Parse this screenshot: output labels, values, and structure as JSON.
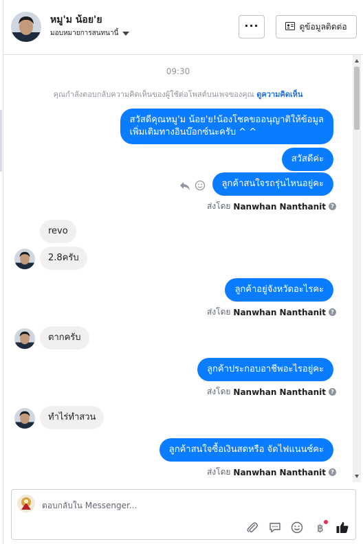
{
  "header": {
    "name": "หมู'ม น้อย'ย",
    "assign_label": "มอบหมายการสนทนานี้",
    "more_label": "···",
    "contact_button": "ดูข้อมูลติดต่อ"
  },
  "chat": {
    "time": "09:30",
    "context_text": "คุณกำลังตอบกลับความคิดเห็นของผู้ใช้ต่อโพสต์บนเพจของคุณ",
    "context_link": "ดูความคิดเห็น",
    "messages": [
      {
        "from": "page",
        "lines": [
          "สวัสดีคุณหมู'ม น้อย'ย!น้องโชคขออนุญาติให้ข้อมูล",
          "เพิ่มเติมทางอินบ๊อกซ์นะครับ ^ ^"
        ]
      },
      {
        "from": "page",
        "text": "สวัสดีค่ะ"
      },
      {
        "from": "page",
        "text": "ลูกค้าสนใจรถรุ่นไหนอยู่คะ"
      },
      {
        "from": "user",
        "text": "revo"
      },
      {
        "from": "user",
        "text": "2.8ครับ"
      },
      {
        "from": "page",
        "text": "ลูกค้าอยู่จังหวัดอะไรคะ"
      },
      {
        "from": "user",
        "text": "ตากครับ"
      },
      {
        "from": "page",
        "text": "ลูกค้าประกอบอาชีพอะไรอยู่คะ"
      },
      {
        "from": "user",
        "text": "ทำไร่ทำสวน"
      },
      {
        "from": "page",
        "text": "ลูกค้าสนใจซื้อเงินสดหรือ จัดไฟแนนซ์คะ"
      }
    ],
    "sent_by_prefix": "ส่งโดย",
    "sent_by_name": "Nanwhan Nanthanit",
    "info_symbol": "?"
  },
  "composer": {
    "placeholder": "ตอบกลับใน Messenger..."
  },
  "icons": [
    "more-icon",
    "contact-card-icon",
    "reply-icon",
    "emoji-icon",
    "attach-icon",
    "saved-reply-icon",
    "emoji-icon",
    "payment-icon",
    "like-icon"
  ],
  "colors": {
    "accent": "#0a7cff",
    "incoming_bubble": "#f0f0f0",
    "link": "#216fdb"
  }
}
